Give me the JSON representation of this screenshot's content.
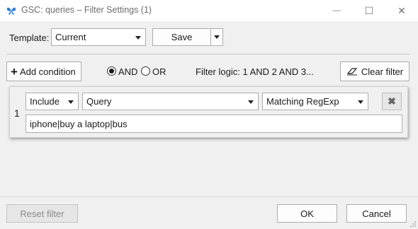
{
  "window": {
    "title": "GSC: queries – Filter Settings (1)",
    "app_icon": "butterfly-icon",
    "minimize_glyph": "—",
    "maximize_glyph": "☐",
    "close_glyph": "✕"
  },
  "template": {
    "label": "Template:",
    "selected": "Current",
    "save_label": "Save"
  },
  "toolbar": {
    "add_condition_icon": "+",
    "add_condition_label": "Add condition",
    "and_label": "AND",
    "or_label": "OR",
    "logic_selected": "AND",
    "filter_logic_text": "Filter logic: 1 AND 2 AND 3...",
    "clear_filter_label": "Clear filter",
    "clear_filter_icon": "eraser-icon"
  },
  "conditions": [
    {
      "number": "1",
      "mode": "Include",
      "field": "Query",
      "operator": "Matching RegExp",
      "value": "iphone|buy a laptop|bus",
      "remove_glyph": "✖"
    }
  ],
  "footer": {
    "reset_label": "Reset filter",
    "ok_label": "OK",
    "cancel_label": "Cancel"
  },
  "colors": {
    "accent": "#2b7bd6",
    "background": "#f0f0f0"
  }
}
